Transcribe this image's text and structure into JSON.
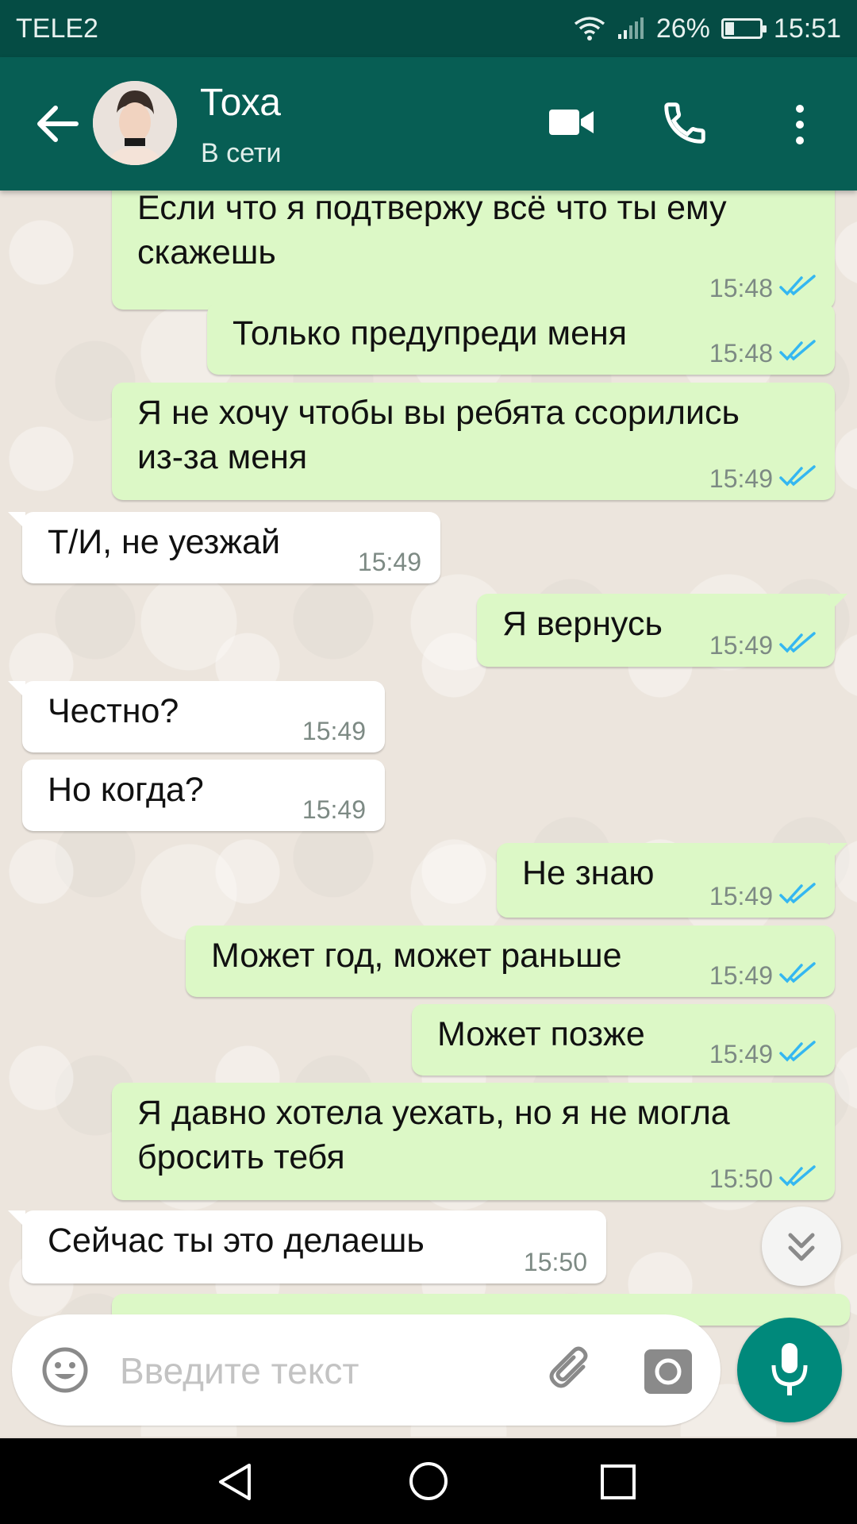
{
  "status_bar": {
    "carrier": "TELE2",
    "battery_percent": "26%",
    "battery_level": 0.26,
    "time": "15:51"
  },
  "header": {
    "contact_name": "Тоха",
    "contact_status": "В сети"
  },
  "colors": {
    "header": "#075e54",
    "status_bar": "#054c44",
    "outgoing_bubble": "#dcf8c6",
    "incoming_bubble": "#ffffff",
    "read_ticks": "#34b7f1",
    "mic_button": "#00897b"
  },
  "messages": [
    {
      "direction": "out",
      "lines": [
        "Если что я подтвержу всё что ты ему",
        "скажешь"
      ],
      "time": "15:48",
      "read": true
    },
    {
      "direction": "out",
      "lines": [
        "Только предупреди меня"
      ],
      "time": "15:48",
      "read": true
    },
    {
      "direction": "out",
      "lines": [
        "Я не хочу чтобы вы ребята ссорились",
        "из-за меня"
      ],
      "time": "15:49",
      "read": true
    },
    {
      "direction": "in",
      "lines": [
        "Т/И, не уезжай"
      ],
      "time": "15:49"
    },
    {
      "direction": "out",
      "lines": [
        "Я вернусь"
      ],
      "time": "15:49",
      "read": true
    },
    {
      "direction": "in",
      "lines": [
        "Честно?"
      ],
      "time": "15:49"
    },
    {
      "direction": "in",
      "lines": [
        "Но когда?"
      ],
      "time": "15:49"
    },
    {
      "direction": "out",
      "lines": [
        "Не знаю"
      ],
      "time": "15:49",
      "read": true
    },
    {
      "direction": "out",
      "lines": [
        "Может год, может раньше"
      ],
      "time": "15:49",
      "read": true
    },
    {
      "direction": "out",
      "lines": [
        "Может позже"
      ],
      "time": "15:49",
      "read": true
    },
    {
      "direction": "out",
      "lines": [
        "Я давно хотела уехать, но я не могла",
        "бросить тебя"
      ],
      "time": "15:50",
      "read": true
    },
    {
      "direction": "in",
      "lines": [
        "Сейчас ты это делаешь"
      ],
      "time": "15:50"
    }
  ],
  "input": {
    "placeholder": "Введите текст",
    "value": ""
  },
  "icons": {
    "back": "arrow-left",
    "video_call": "video-camera",
    "voice_call": "phone",
    "more": "dots-vertical",
    "emoji": "smiley",
    "attach": "paperclip",
    "camera": "camera",
    "mic": "microphone",
    "scroll_down": "double-chevron-down",
    "read": "double-check"
  }
}
